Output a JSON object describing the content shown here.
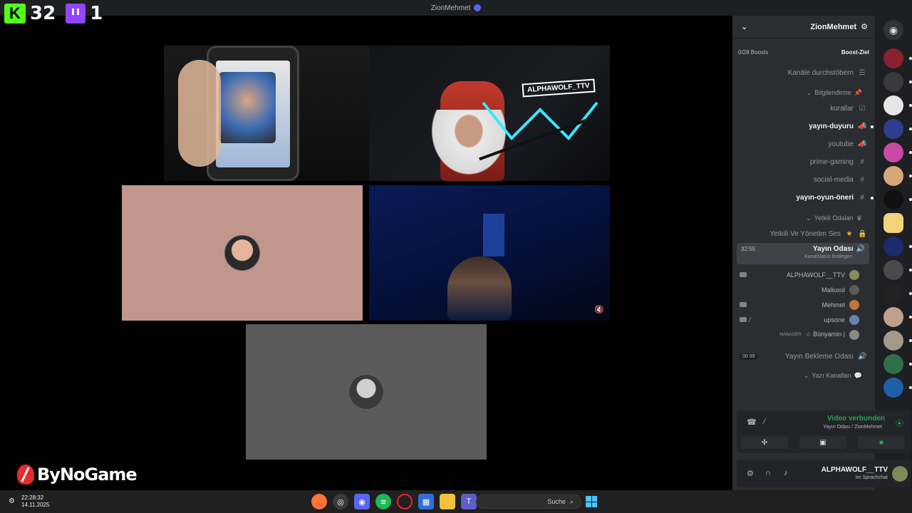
{
  "titlebar": {
    "title": "ZionMehmet"
  },
  "overlay": {
    "kick_count": "32",
    "twitch_count": "1",
    "kick_logo_text": "K"
  },
  "stage": {
    "tiles": [
      {
        "name": "phone-stream"
      },
      {
        "name": "game-room-stream",
        "tag_text": "ALPHAWOLF_TTV"
      },
      {
        "name": "pink-avatar-tile"
      },
      {
        "name": "blue-room-stream"
      },
      {
        "name": "gray-avatar-tile"
      }
    ]
  },
  "watermark": {
    "text": "ByNoGame"
  },
  "discord": {
    "server_name": "ZionMehmet",
    "boost_label": "Boost-Ziel",
    "boost_value": "0/28 Boosts",
    "browse_channels": "Kanäle durchstöbern",
    "categories": {
      "info": "Bilgilendirme",
      "auth": "Yetkili Odaları",
      "text": "Yazı Kanalları"
    },
    "channels": [
      {
        "label": "kurallar",
        "icon": "✓",
        "bold": false
      },
      {
        "label": "yayın-duyuru",
        "icon": "📢",
        "bold": true
      },
      {
        "label": "youtube",
        "icon": "📢",
        "bold": false
      },
      {
        "label": "prime-gaming",
        "icon": "#",
        "bold": false
      },
      {
        "label": "social-media",
        "icon": "#",
        "bold": false
      },
      {
        "label": "yayın-oyun-öneri",
        "icon": "#",
        "bold": true
      }
    ],
    "locked_channel": "Yetkili Ve Yönetim Ses",
    "active_voice": {
      "name": "Yayın Odası",
      "time": "32:55",
      "status_hint": "Kanalstatus festlegen"
    },
    "members": [
      {
        "name": "ALPHAWOLF__TTV",
        "camera": true,
        "tag": ""
      },
      {
        "name": "Maliuxul",
        "camera": false,
        "tag": ""
      },
      {
        "name": "Mehmet",
        "camera": true,
        "tag": ""
      },
      {
        "name": "upsone",
        "camera": true,
        "tag": ""
      },
      {
        "name": "☆ Bünyamin |",
        "camera": false,
        "tag": "MANAGER"
      }
    ],
    "waiting_room": {
      "name": "Yayın Bekleme Odası",
      "badge": "00 99"
    },
    "voice_panel": {
      "status": "Video verbunden",
      "sub": "Yayın Odası / ZionMehmet"
    },
    "user_panel": {
      "name": "ALPHAWOLF__TTV",
      "sub": "Im Sprachchat"
    }
  },
  "taskbar": {
    "time": "22:28:32",
    "date": "14.11.2025",
    "search_placeholder": "Suche"
  }
}
